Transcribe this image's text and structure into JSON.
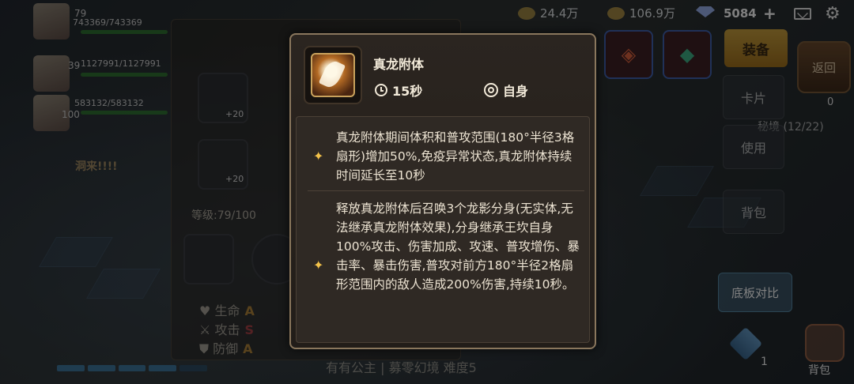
{
  "resources": [
    {
      "name": "gold-icon",
      "value": "24.4万",
      "color": "#d9b14a"
    },
    {
      "name": "coin-icon",
      "value": "106.9万",
      "color": "#e1b54a"
    },
    {
      "name": "gem-icon",
      "value": "5084",
      "color": "#8aa0d8"
    }
  ],
  "party": [
    {
      "level": "79",
      "hp": "743369/743369"
    },
    {
      "level": "39",
      "hp": "1127991/1127991"
    },
    {
      "level": "100",
      "hp": "583132/583132"
    }
  ],
  "chat_snippet": "洞来!!!!",
  "hero": {
    "level_label": "等级:79/100",
    "stats": [
      {
        "label": "生命",
        "grade": "A"
      },
      {
        "label": "攻击",
        "grade": "S"
      },
      {
        "label": "防御",
        "grade": "A"
      }
    ],
    "slot_bonus": "+20"
  },
  "bottom_chat": "有有公主 | 募零幻境 难度5",
  "right": {
    "equip_label": "装备",
    "back_label": "返回",
    "card_label": "卡片",
    "use_label": "使用",
    "bag_label_side": "背包",
    "secret_label": "秘境 (12/22)",
    "gem_small": "0",
    "compare_label": "底板对比",
    "bag_label": "背包",
    "count": "1"
  },
  "tooltip": {
    "skill_name": "真龙附体",
    "cooldown": "15秒",
    "target": "自身",
    "descriptions": [
      "真龙附体期间体积和普攻范围(180°半径3格扇形)增加50%,免疫异常状态,真龙附体持续时间延长至10秒",
      "释放真龙附体后召唤3个龙影分身(无实体,无法继承真龙附体效果),分身继承王坎自身100%攻击、伤害加成、攻速、普攻增伤、暴击率、暴击伤害,普攻对前方180°半径2格扇形范围内的敌人造成200%伤害,持续10秒。"
    ]
  }
}
